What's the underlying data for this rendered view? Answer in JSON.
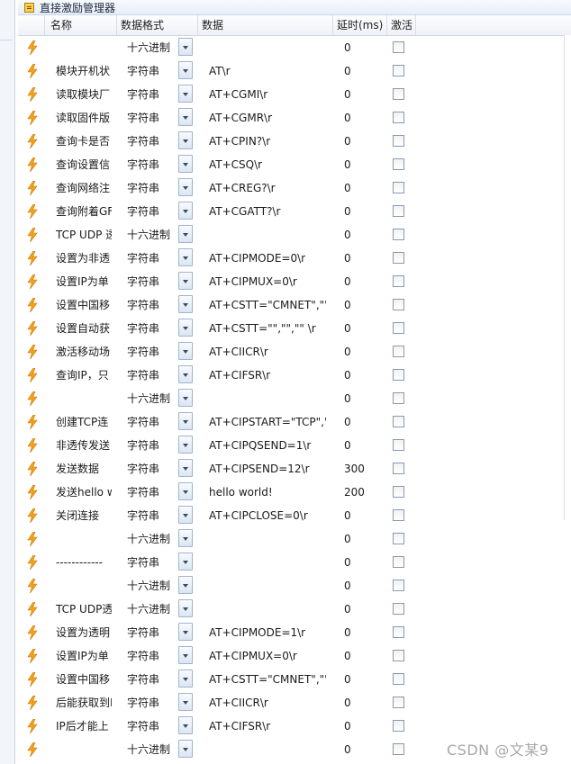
{
  "window": {
    "title": "直接激励管理器"
  },
  "columns": {
    "name": "名称",
    "format": "数据格式",
    "data": "数据",
    "delay": "延时(ms)",
    "active": "激活"
  },
  "rows": [
    {
      "name": "",
      "format": "十六进制",
      "data": "",
      "delay": "0",
      "active": false
    },
    {
      "name": "模块开机状",
      "format": "字符串",
      "data": "AT\\r",
      "delay": "0",
      "active": false
    },
    {
      "name": "读取模块厂",
      "format": "字符串",
      "data": "AT+CGMI\\r",
      "delay": "0",
      "active": false
    },
    {
      "name": "读取固件版",
      "format": "字符串",
      "data": "AT+CGMR\\r",
      "delay": "0",
      "active": false
    },
    {
      "name": "查询卡是否",
      "format": "字符串",
      "data": "AT+CPIN?\\r",
      "delay": "0",
      "active": false
    },
    {
      "name": "查询设置信",
      "format": "字符串",
      "data": "AT+CSQ\\r",
      "delay": "0",
      "active": false
    },
    {
      "name": "查询网络注",
      "format": "字符串",
      "data": "AT+CREG?\\r",
      "delay": "0",
      "active": false
    },
    {
      "name": "查询附着GF",
      "format": "字符串",
      "data": "AT+CGATT?\\r",
      "delay": "0",
      "active": false
    },
    {
      "name": "TCP UDP 透",
      "format": "十六进制",
      "data": "",
      "delay": "0",
      "active": false
    },
    {
      "name": "设置为非透",
      "format": "字符串",
      "data": "AT+CIPMODE=0\\r",
      "delay": "0",
      "active": false
    },
    {
      "name": "设置IP为单",
      "format": "字符串",
      "data": "AT+CIPMUX=0\\r",
      "delay": "0",
      "active": false
    },
    {
      "name": "设置中国移",
      "format": "字符串",
      "data": "AT+CSTT=\"CMNET\",\"\"",
      "delay": "0",
      "active": false
    },
    {
      "name": "设置自动获",
      "format": "字符串",
      "data": "AT+CSTT=\"\",\"\",\"\" \\r",
      "delay": "0",
      "active": false
    },
    {
      "name": "激活移动场",
      "format": "字符串",
      "data": "AT+CIICR\\r",
      "delay": "0",
      "active": false
    },
    {
      "name": "查询IP，只",
      "format": "字符串",
      "data": "AT+CIFSR\\r",
      "delay": "0",
      "active": false
    },
    {
      "name": "",
      "format": "十六进制",
      "data": "",
      "delay": "0",
      "active": false
    },
    {
      "name": "创建TCP连",
      "format": "字符串",
      "data": "AT+CIPSTART=\"TCP\",'",
      "delay": "0",
      "active": false
    },
    {
      "name": "非透传发送",
      "format": "字符串",
      "data": "AT+CIPQSEND=1\\r",
      "delay": "0",
      "active": false
    },
    {
      "name": "发送数据",
      "format": "字符串",
      "data": "AT+CIPSEND=12\\r",
      "delay": "300",
      "active": false
    },
    {
      "name": "发送hello w",
      "format": "字符串",
      "data": "hello world!",
      "delay": "200",
      "active": false
    },
    {
      "name": "关闭连接",
      "format": "字符串",
      "data": "AT+CIPCLOSE=0\\r",
      "delay": "0",
      "active": false
    },
    {
      "name": "",
      "format": "十六进制",
      "data": "",
      "delay": "0",
      "active": false
    },
    {
      "name": "------------",
      "format": "字符串",
      "data": "",
      "delay": "0",
      "active": false
    },
    {
      "name": "",
      "format": "十六进制",
      "data": "",
      "delay": "0",
      "active": false
    },
    {
      "name": "TCP UDP透",
      "format": "十六进制",
      "data": "",
      "delay": "0",
      "active": false
    },
    {
      "name": "设置为透明",
      "format": "字符串",
      "data": "AT+CIPMODE=1\\r",
      "delay": "0",
      "active": false
    },
    {
      "name": "设置IP为单",
      "format": "字符串",
      "data": "AT+CIPMUX=0\\r",
      "delay": "0",
      "active": false
    },
    {
      "name": "设置中国移",
      "format": "字符串",
      "data": "AT+CSTT=\"CMNET\",\"\"",
      "delay": "0",
      "active": false
    },
    {
      "name": "后能获取到I",
      "format": "字符串",
      "data": "AT+CIICR\\r",
      "delay": "0",
      "active": false
    },
    {
      "name": "IP后才能上",
      "format": "字符串",
      "data": "AT+CIFSR\\r",
      "delay": "0",
      "active": false
    },
    {
      "name": "",
      "format": "十六进制",
      "data": "",
      "delay": "0",
      "active": false
    }
  ],
  "icons": {
    "row_icon": "lightning-bolt-icon",
    "title_icon": "clipboard-icon"
  },
  "colors": {
    "bolt_fill": "#f5a21b",
    "bolt_stroke": "#c77400"
  },
  "watermark": "CSDN @文某9"
}
